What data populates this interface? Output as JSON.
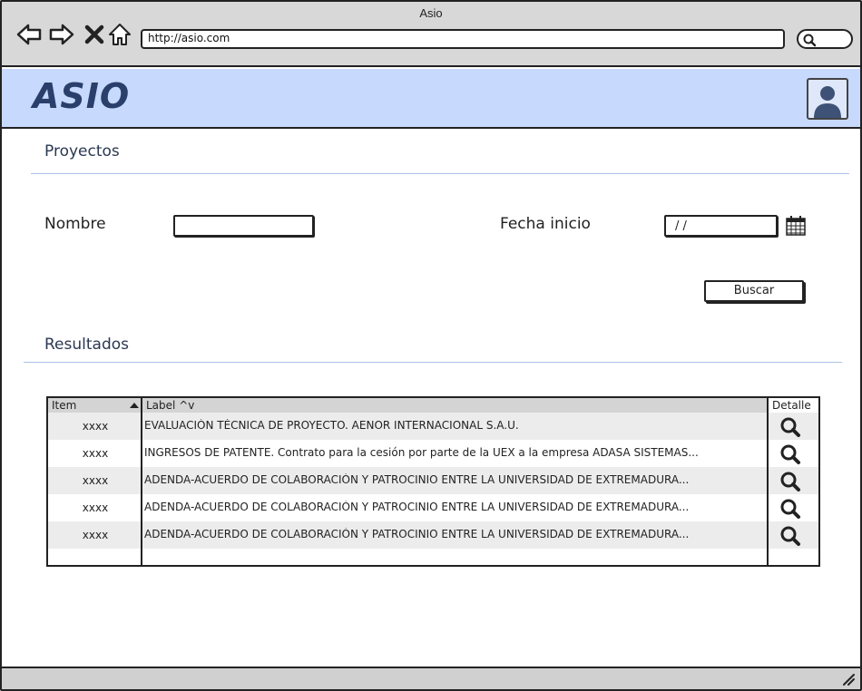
{
  "browser": {
    "window_title": "Asio",
    "url": "http://asio.com"
  },
  "header": {
    "logo": "ASIO"
  },
  "search_section": {
    "title": "Proyectos",
    "nombre_label": "Nombre",
    "nombre_value": "",
    "fecha_label": "Fecha inicio",
    "fecha_value": " /  /",
    "search_button": "Buscar"
  },
  "results": {
    "title": "Resultados",
    "columns": [
      "Item",
      "Label ^v",
      "Detalle"
    ],
    "rows": [
      {
        "item": "xxxx",
        "label": "EVALUACIÓN TÉCNICA DE PROYECTO. AENOR INTERNACIONAL S.A.U."
      },
      {
        "item": "xxxx",
        "label": "INGRESOS DE PATENTE. Contrato para la cesión por parte de la UEX a la empresa ADASA SISTEMAS..."
      },
      {
        "item": "xxxx",
        "label": "ADENDA-ACUERDO DE COLABORACIÓN Y PATROCINIO ENTRE LA UNIVERSIDAD DE EXTREMADURA..."
      },
      {
        "item": "xxxx",
        "label": "ADENDA-ACUERDO DE COLABORACIÓN Y PATROCINIO ENTRE LA UNIVERSIDAD DE EXTREMADURA..."
      },
      {
        "item": "xxxx",
        "label": "ADENDA-ACUERDO DE COLABORACIÓN Y PATROCINIO ENTRE LA UNIVERSIDAD DE EXTREMADURA..."
      }
    ]
  },
  "colors": {
    "header_bg": "#c7d9fd",
    "logo": "#2b3f6b",
    "chrome_bg": "#d8d8d8",
    "row_alt": "#ececec"
  },
  "icons": {
    "back": "arrow-left-icon",
    "forward": "arrow-right-icon",
    "stop": "close-icon",
    "home": "home-icon",
    "browser_search": "search-icon",
    "user": "user-icon",
    "calendar": "calendar-icon",
    "detail": "magnifier-icon"
  }
}
